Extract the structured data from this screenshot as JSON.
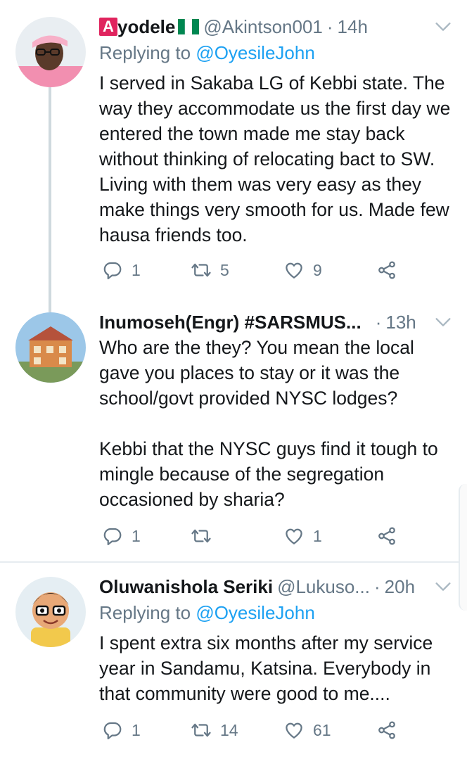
{
  "tweets": [
    {
      "badge": "A",
      "name": "yodele",
      "handle": "@Akintson001",
      "sep": "·",
      "time": "14h",
      "reply_prefix": "Replying to",
      "reply_mention": "@OyesileJohn",
      "text": "I served in Sakaba LG of Kebbi state. The way they accommodate us the first day we entered the town made me stay back without thinking of relocating bact to SW. Living with them was very easy as they make things very smooth for us. Made few hausa friends too.",
      "replies": "1",
      "retweets": "5",
      "likes": "9"
    },
    {
      "name": "Inumoseh(Engr) #SARSMUS...",
      "sep": "·",
      "time": "13h",
      "text": "Who are the they? You mean the local gave you places to stay or it was the school/govt provided NYSC lodges?\n\nKebbi that the NYSC guys find it tough to mingle because of the segregation occasioned by sharia?",
      "replies": "1",
      "retweets": "",
      "likes": "1"
    },
    {
      "name": "Oluwanishola Seriki",
      "handle": "@Lukuso...",
      "sep": "·",
      "time": "20h",
      "reply_prefix": "Replying to",
      "reply_mention": "@OyesileJohn",
      "text": "I spent extra six months after my service year in Sandamu, Katsina. Everybody in that community were good to me....",
      "replies": "1",
      "retweets": "14",
      "likes": "61"
    }
  ],
  "icons": {
    "reply": "reply-icon",
    "retweet": "retweet-icon",
    "like": "heart-icon",
    "share": "share-icon",
    "caret": "chevron-down-icon"
  },
  "colors": {
    "text": "#14171a",
    "muted": "#657786",
    "link": "#1da1f2",
    "divider": "#e6ecf0",
    "thread": "#cfd9de"
  }
}
